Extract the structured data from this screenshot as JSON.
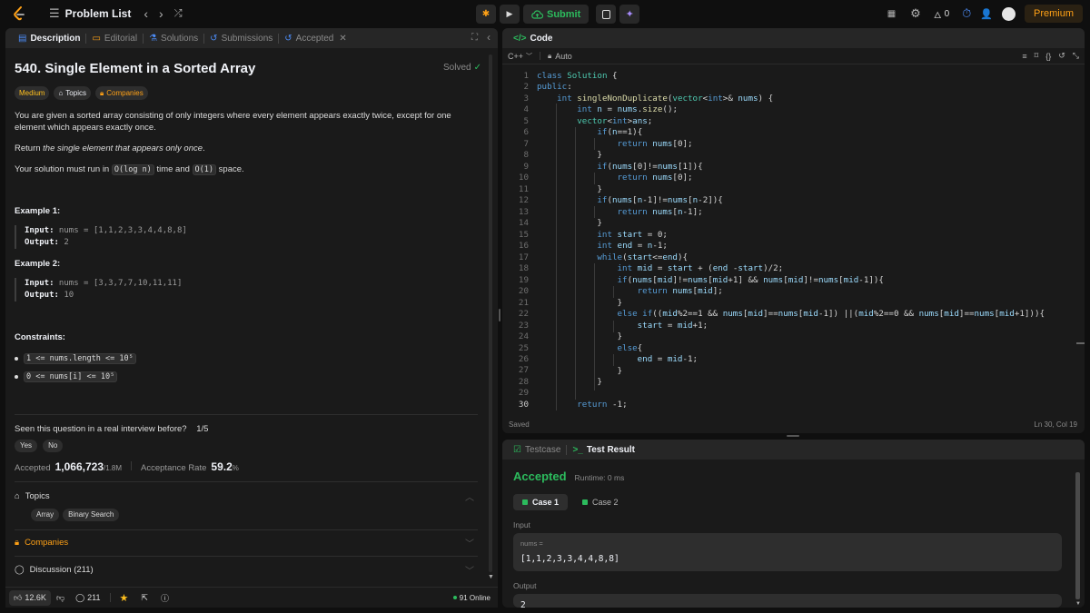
{
  "topbar": {
    "title": "Problem List",
    "submit_label": "Submit",
    "fire_count": "0",
    "premium_label": "Premium"
  },
  "left_tabs": {
    "description": "Description",
    "editorial": "Editorial",
    "solutions": "Solutions",
    "submissions": "Submissions",
    "accepted": "Accepted"
  },
  "problem": {
    "title": "540. Single Element in a Sorted Array",
    "status": "Solved",
    "difficulty": "Medium",
    "topics_chip": "Topics",
    "companies_chip": "Companies",
    "p1": "You are given a sorted array consisting of only integers where every element appears exactly twice, except for one element which appears exactly once.",
    "p2_prefix": "Return ",
    "p2_em": "the single element that appears only once",
    "p2_suffix": ".",
    "p3_prefix": "Your solution must run in ",
    "p3_code1": "O(log n)",
    "p3_mid": " time and ",
    "p3_code2": "O(1)",
    "p3_suffix": " space.",
    "example1_title": "Example 1:",
    "example1_input_label": "Input:",
    "example1_input": " nums = [1,1,2,3,3,4,4,8,8]",
    "example1_output_label": "Output:",
    "example1_output": " 2",
    "example2_title": "Example 2:",
    "example2_input_label": "Input:",
    "example2_input": " nums = [3,3,7,7,10,11,11]",
    "example2_output_label": "Output:",
    "example2_output": " 10",
    "constraints_title": "Constraints:",
    "constraint1": "1 <= nums.length <= 10⁵",
    "constraint2": "0 <= nums[i] <= 10⁵",
    "interview_q": "Seen this question in a real interview before?",
    "interview_count": "1/5",
    "yes": "Yes",
    "no": "No",
    "accepted_label": "Accepted",
    "accepted_value": "1,066,723",
    "accepted_total": "/1.8M",
    "acceptance_label": "Acceptance Rate",
    "acceptance_value": "59.2",
    "acceptance_unit": "%",
    "topics_section": "Topics",
    "topic_tags": [
      "Array",
      "Binary Search"
    ],
    "companies_section": "Companies",
    "discussion_section": "Discussion (211)"
  },
  "bottom": {
    "likes": "12.6K",
    "comments": "211",
    "online": "91 Online"
  },
  "editor": {
    "header": "Code",
    "language": "C++",
    "mode": "Auto",
    "saved": "Saved",
    "cursor": "Ln 30, Col 19",
    "line_numbers": [
      "1",
      "2",
      "3",
      "4",
      "5",
      "6",
      "7",
      "8",
      "9",
      "10",
      "11",
      "12",
      "13",
      "14",
      "15",
      "16",
      "17",
      "18",
      "19",
      "20",
      "21",
      "22",
      "23",
      "24",
      "25",
      "26",
      "27",
      "28",
      "29",
      "30"
    ]
  },
  "result": {
    "tab_testcase": "Testcase",
    "tab_result": "Test Result",
    "status": "Accepted",
    "runtime": "Runtime: 0 ms",
    "case1": "Case 1",
    "case2": "Case 2",
    "input_label": "Input",
    "var_name": "nums =",
    "var_value": "[1,1,2,3,3,4,4,8,8]",
    "output_label": "Output",
    "output_value": "2"
  },
  "colors": {
    "accent_orange": "#ffa116",
    "green": "#2cbb5d",
    "blue": "#4c8bf5"
  }
}
